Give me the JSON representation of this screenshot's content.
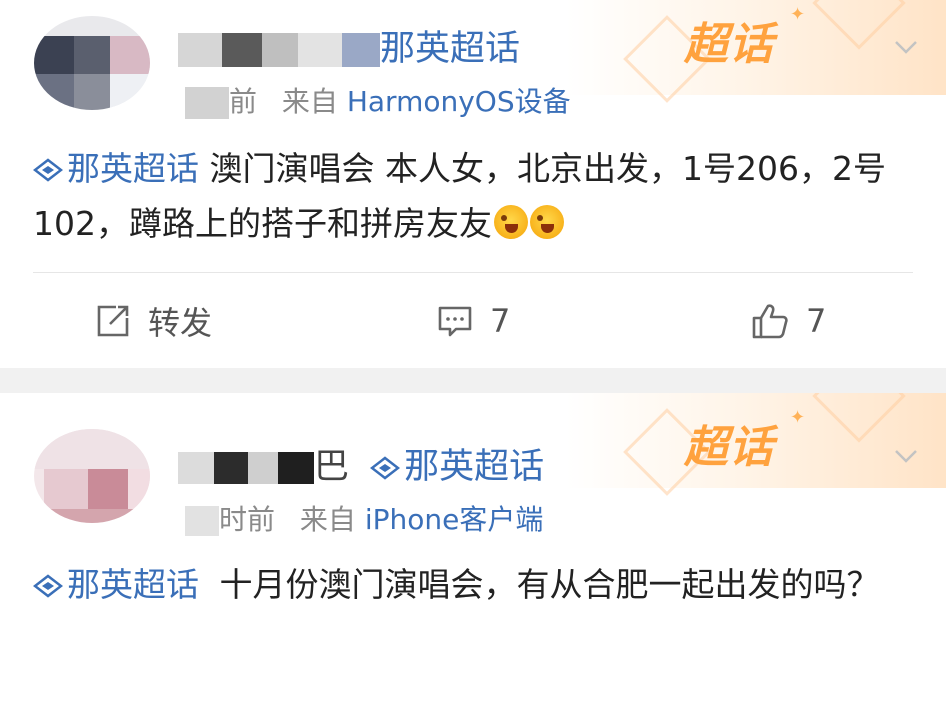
{
  "posts": [
    {
      "banner": {
        "text": "超话"
      },
      "user": {
        "name_visible": "那英超话"
      },
      "meta": {
        "time_visible": "前",
        "from_label": "来自",
        "source": "HarmonyOS设备"
      },
      "topic": "那英超话",
      "content": "澳门演唱会 本人女，北京出发，1号206，2号102，蹲路上的搭子和拼房友友",
      "emoji_icon": "crying-laughing-emoji",
      "actions": {
        "repost_label": "转发",
        "comment_count": "7",
        "like_count": "7"
      }
    },
    {
      "banner": {
        "text": "超话"
      },
      "user": {
        "name_visible": "巴",
        "topic_badge": "那英超话"
      },
      "meta": {
        "time_visible": "时前",
        "from_label": "来自",
        "source": "iPhone客户端"
      },
      "topic": "那英超话",
      "content": "十月份澳门演唱会，有从合肥一起出发的吗？"
    }
  ],
  "colors": {
    "link": "#3a6fb8",
    "accent": "#ffa23e",
    "separator": "#f1f1f1",
    "text": "#222222",
    "meta": "#8a8a8a"
  }
}
